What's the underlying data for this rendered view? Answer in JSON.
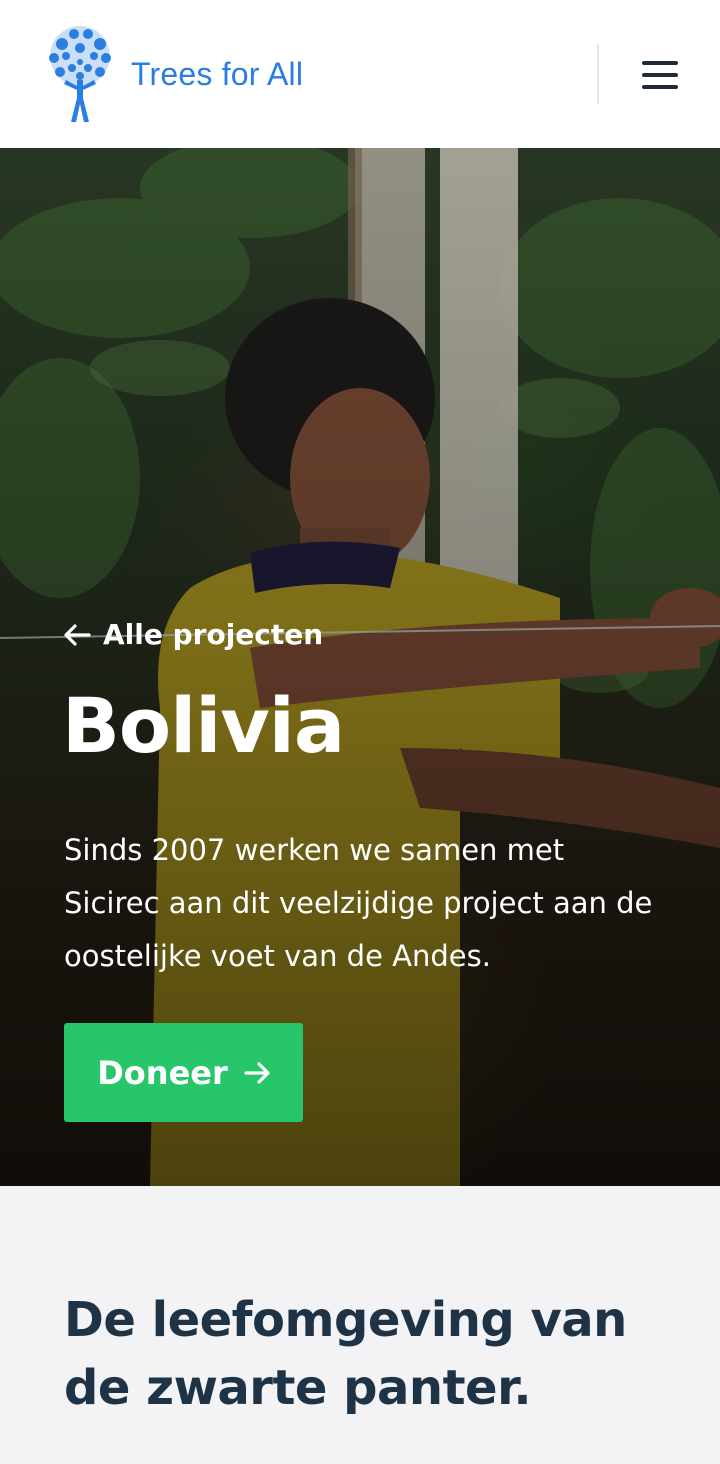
{
  "header": {
    "brand": "Trees for All",
    "logo_icon": "tree-person-logo-icon",
    "menu_icon": "hamburger-menu-icon",
    "brand_color": "#2a7de1"
  },
  "hero": {
    "back_link": "Alle projecten",
    "back_icon": "arrow-left-icon",
    "title": "Bolivia",
    "description": "Sinds 2007 werken we samen met Sicirec aan dit veelzijdige project aan de oostelijke voet van de Andes.",
    "donate_label": "Doneer",
    "donate_icon": "arrow-right-icon",
    "donate_color": "#28c66b"
  },
  "section": {
    "title": "De leefomgeving van de zwarte panter."
  }
}
